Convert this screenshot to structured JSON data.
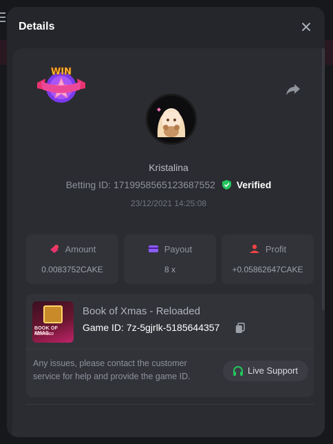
{
  "modal": {
    "title": "Details"
  },
  "badge": {
    "text": "WIN"
  },
  "user": {
    "name": "Kristalina",
    "betting_id_label": "Betting ID:",
    "betting_id": "1719958565123687552",
    "verified_label": "Verified",
    "datetime": "23/12/2021 14:25:08"
  },
  "stats": [
    {
      "label": "Amount",
      "value": "0.0083752CAKE",
      "icon": "chips-icon"
    },
    {
      "label": "Payout",
      "value": "8 x",
      "icon": "card-icon"
    },
    {
      "label": "Profit",
      "value": "+0.05862647CAKE",
      "icon": "profit-user-icon"
    }
  ],
  "game": {
    "title": "Book of Xmas - Reloaded",
    "id_label": "Game ID:",
    "id": "7z-5gjrlk-5185644357",
    "thumb_line1": "BOOK OF XMAS",
    "thumb_line2": "RELOADED",
    "support_text": "Any issues, please contact the customer service for help and provide the game ID.",
    "support_button": "Live Support"
  },
  "colors": {
    "modal_bg": "#25262b",
    "panel_bg": "#2b2c31",
    "card_bg": "#323339",
    "verified_green": "#22c55e",
    "accent_pink": "#e8336e",
    "accent_purple": "#8b5cf6"
  }
}
